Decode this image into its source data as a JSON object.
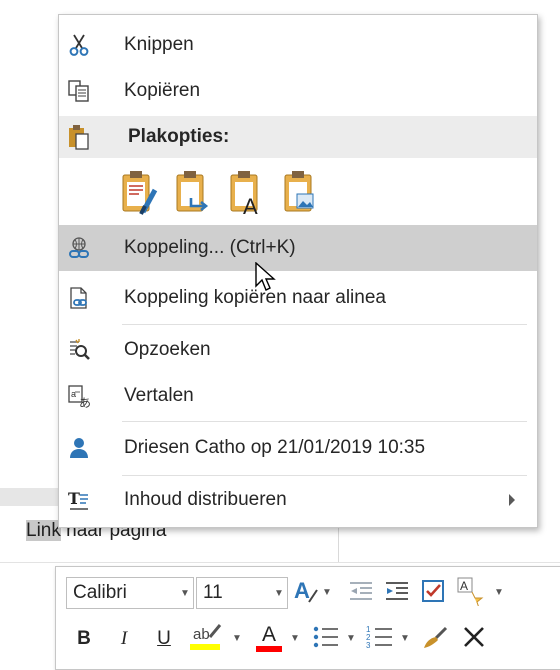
{
  "menu": {
    "items": [
      {
        "label": "Knippen",
        "icon": "scissors-icon"
      },
      {
        "label": "Kopiëren",
        "icon": "copy-icon"
      },
      {
        "label": "Plakopties:",
        "icon": "paste-icon"
      },
      {
        "label": "Koppeling...  (Ctrl+K)",
        "icon": "link-icon"
      },
      {
        "label": "Koppeling kopiëren naar alinea",
        "icon": "copy-link-icon"
      },
      {
        "label": "Opzoeken",
        "icon": "smart-lookup-icon"
      },
      {
        "label": "Vertalen",
        "icon": "translate-icon"
      },
      {
        "label": "Driesen Catho op 21/01/2019 10:35",
        "icon": "person-icon"
      },
      {
        "label": "Inhoud distribueren",
        "icon": "distribute-icon"
      }
    ],
    "paste_options": [
      "keep-source-formatting-icon",
      "merge-formatting-icon",
      "keep-text-only-icon",
      "picture-icon"
    ]
  },
  "document": {
    "selected_word": "Link",
    "rest_text": " naar pagina"
  },
  "toolbar": {
    "font_name": "Calibri",
    "font_size": "11",
    "bold": "B",
    "italic": "I",
    "underline": "U",
    "font_color_letter": "A",
    "highlight_color": "#ffff00",
    "font_color": "#ff0000"
  },
  "colors": {
    "hover": "#cfcfcf",
    "header": "#ececec",
    "icon_blue": "#2e75b6",
    "icon_gold": "#c8912b"
  }
}
